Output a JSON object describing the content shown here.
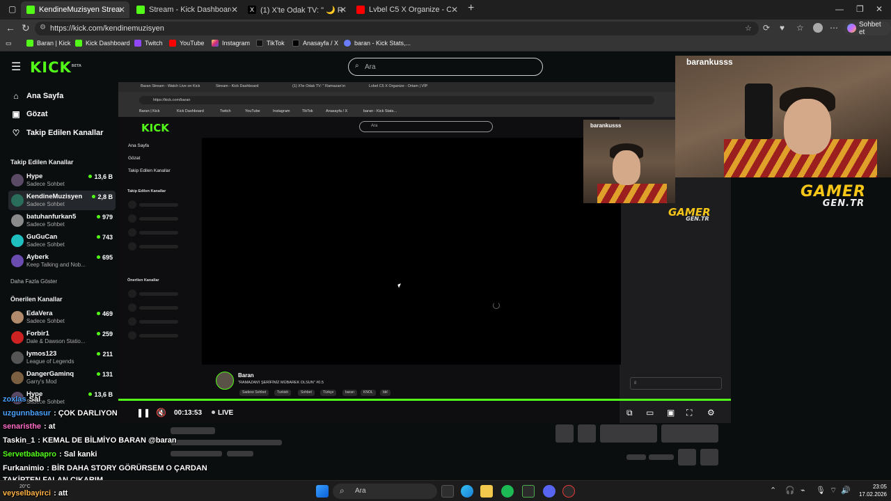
{
  "browser": {
    "tabs": [
      {
        "title": "KendineMuzisyen Stream - Watch",
        "active": true,
        "color": "#53fc18"
      },
      {
        "title": "Stream - Kick Dashboard",
        "active": false,
        "color": "#53fc18"
      },
      {
        "title": "(1) X'te Odak TV: \" 🌙 Ramazan'ın",
        "active": false,
        "color": "#ffffff"
      },
      {
        "title": "Lvbel C5 X Organize - Ortam | VİP",
        "active": false,
        "color": "#ff0000"
      }
    ],
    "url": "https://kick.com/kendinemuzisyen",
    "profile_label": "Sohbet et",
    "bookmarks": [
      "Baran | Kick",
      "Kick Dashboard",
      "Twitch",
      "YouTube",
      "Instagram",
      "TikTok",
      "Anasayfa / X",
      "baran - Kick Stats,..."
    ]
  },
  "kick": {
    "logo": "KICK",
    "logo_beta": "BETA",
    "search_placeholder": "Ara",
    "nav": [
      "Ana Sayfa",
      "Gözat",
      "Takip Edilen Kanallar"
    ],
    "followed_heading": "Takip Edilen Kanallar",
    "followed": [
      {
        "name": "Hype",
        "category": "Sadece Sohbet",
        "viewers": "13,6 B"
      },
      {
        "name": "KendineMuzisyen",
        "category": "Sadece Sohbet",
        "viewers": "2,8 B"
      },
      {
        "name": "batuhanfurkan5",
        "category": "Sadece Sohbet",
        "viewers": "979"
      },
      {
        "name": "GuGuCan",
        "category": "Sadece Sohbet",
        "viewers": "743"
      },
      {
        "name": "Ayberk",
        "category": "Keep Talking and Nob...",
        "viewers": "695"
      }
    ],
    "show_more": "Daha Fazla Göster",
    "recommended_heading": "Önerilen Kanallar",
    "recommended": [
      {
        "name": "EdaVera",
        "category": "Sadece Sohbet",
        "viewers": "469"
      },
      {
        "name": "Forbir1",
        "category": "Dale & Dawson Statio...",
        "viewers": "259"
      },
      {
        "name": "Iymos123",
        "category": "League of Legends",
        "viewers": "211"
      },
      {
        "name": "DangerGaminq",
        "category": "Garry's Mod",
        "viewers": "131"
      },
      {
        "name": "Hype",
        "category": "Sadece Sohbet",
        "viewers": "13,6 B"
      }
    ]
  },
  "stream": {
    "inner_tabs": [
      "Baran Stream - Watch Live on Kick",
      "Stream - Kick Dashboard",
      "(1) X'te Odak TV: \" Ramazan'ın",
      "Lvbel C5 X Organize - Ortam | VİP"
    ],
    "inner_url": "https://kick.com/baran",
    "inner_bookmarks": [
      "Baran | Kick",
      "Kick Dashboard",
      "Twitch",
      "YouTube",
      "Instagram",
      "TikTok",
      "Anasayfa / X",
      "baran - Kick Stats..."
    ],
    "inner_logo": "KICK",
    "inner_search": "Ara",
    "inner_nav": [
      "Ana Sayfa",
      "Gözat",
      "Takip Edilen Kanallar"
    ],
    "inner_followed": "Takip Edilen Kanallar",
    "inner_recommended": "Önerilen Kanallar",
    "inner_streamer": "Baran",
    "inner_title": "\"RAMAZAN'I ŞERİFİNİZ MÜBAREK OLSUN\" #0.5",
    "inner_tags": [
      "Sadece Sohbet",
      "Turkish",
      "Sohbet",
      "Türkçe",
      "baran",
      "KNOL",
      "bbl"
    ],
    "inner_chat_input": "8",
    "webcam_user": "barankusss",
    "gamer_logo": "GAMER",
    "gamer_sub": "GEN.TR",
    "time": "00:13:53",
    "live_label": "LIVE"
  },
  "webcam": {
    "username": "barankusss",
    "logo": "GAMER",
    "logo_sub": "GEN.TR"
  },
  "chat_overlay": [
    {
      "user": "zoxlas",
      "text": "Sal",
      "color": "#4aa3ff"
    },
    {
      "user": "uzgunnbasur",
      "text": ": ÇOK DARLIYON",
      "color": "#4aa3ff"
    },
    {
      "user": "senaristhe",
      "text": ": at",
      "color": "#ff6ec7"
    },
    {
      "user": "Taskin_1",
      "text": ": KEMAL DE BİLMİYO BARAN @baran",
      "color": "#ffffff"
    },
    {
      "user": "Servetbabapro",
      "text": ": Sal kanki",
      "color": "#53fc18"
    },
    {
      "user": "Furkanimio",
      "text": ": BİR DAHA STORY GÖRÜRSEM O ÇARDAN",
      "color": "#ffffff"
    },
    {
      "user": "",
      "text": "TAKİPTEN FALAN ÇIKARIM",
      "color": "#ffffff"
    },
    {
      "user": "veyselbayirci",
      "text": ": att",
      "color": "#ffb347"
    }
  ],
  "taskbar": {
    "search": "Ara",
    "time": "23:05",
    "date": "17.02.2026",
    "weather": "20°C"
  }
}
